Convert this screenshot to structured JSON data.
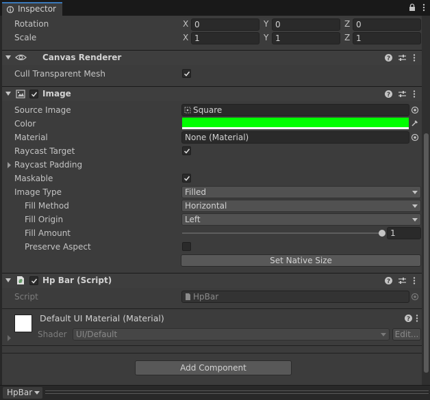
{
  "window": {
    "tab_title": "Inspector"
  },
  "transform": {
    "rotation": {
      "label": "Rotation",
      "x": "0",
      "y": "0",
      "z": "0"
    },
    "scale": {
      "label": "Scale",
      "x": "1",
      "y": "1",
      "z": "1"
    },
    "axis_x": "X",
    "axis_y": "Y",
    "axis_z": "Z"
  },
  "canvas_renderer": {
    "title": "Canvas Renderer",
    "cull_transparent_mesh": {
      "label": "Cull Transparent Mesh",
      "checked": true
    }
  },
  "image": {
    "title": "Image",
    "enabled": true,
    "source_image": {
      "label": "Source Image",
      "value": "Square"
    },
    "color": {
      "label": "Color",
      "value": "#00ff00"
    },
    "material": {
      "label": "Material",
      "value": "None (Material)"
    },
    "raycast_target": {
      "label": "Raycast Target",
      "checked": true
    },
    "raycast_padding": {
      "label": "Raycast Padding"
    },
    "maskable": {
      "label": "Maskable",
      "checked": true
    },
    "image_type": {
      "label": "Image Type",
      "value": "Filled"
    },
    "fill_method": {
      "label": "Fill Method",
      "value": "Horizontal"
    },
    "fill_origin": {
      "label": "Fill Origin",
      "value": "Left"
    },
    "fill_amount": {
      "label": "Fill Amount",
      "value": "1",
      "fraction": 1.0
    },
    "preserve_aspect": {
      "label": "Preserve Aspect",
      "checked": false
    },
    "set_native_size_label": "Set Native Size"
  },
  "hp_bar_script": {
    "title": "Hp Bar (Script)",
    "enabled": true,
    "script": {
      "label": "Script",
      "value": "HpBar"
    }
  },
  "material_block": {
    "title": "Default UI Material (Material)",
    "shader_label": "Shader",
    "shader_value": "UI/Default",
    "edit_label": "Edit..."
  },
  "add_component_label": "Add Component",
  "bottom": {
    "object_name": "HpBar"
  },
  "colors": {
    "accent": "#3a79bb",
    "image_color": "#00ff00"
  }
}
